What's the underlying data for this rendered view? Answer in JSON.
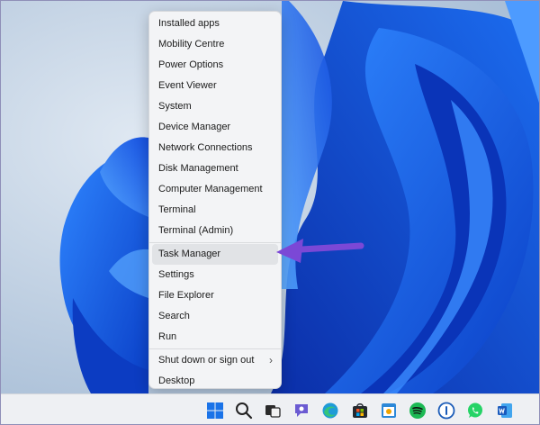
{
  "context_menu": {
    "items": [
      {
        "label": "Installed apps"
      },
      {
        "label": "Mobility Centre"
      },
      {
        "label": "Power Options"
      },
      {
        "label": "Event Viewer"
      },
      {
        "label": "System"
      },
      {
        "label": "Device Manager"
      },
      {
        "label": "Network Connections"
      },
      {
        "label": "Disk Management"
      },
      {
        "label": "Computer Management"
      },
      {
        "label": "Terminal"
      },
      {
        "label": "Terminal (Admin)"
      },
      {
        "label": "Task Manager"
      },
      {
        "label": "Settings"
      },
      {
        "label": "File Explorer"
      },
      {
        "label": "Search"
      },
      {
        "label": "Run"
      },
      {
        "label": "Shut down or sign out"
      },
      {
        "label": "Desktop"
      }
    ],
    "highlighted_item": "Task Manager",
    "submenu_chevron": "›"
  },
  "annotation": {
    "arrow_color": "#7b48d6",
    "points_to": "Task Manager"
  },
  "taskbar": {
    "icons": [
      {
        "name": "start-icon"
      },
      {
        "name": "search-icon"
      },
      {
        "name": "task-view-icon"
      },
      {
        "name": "chat-icon"
      },
      {
        "name": "edge-icon"
      },
      {
        "name": "store-icon"
      },
      {
        "name": "calendar-app-icon"
      },
      {
        "name": "spotify-icon"
      },
      {
        "name": "password-manager-icon"
      },
      {
        "name": "whatsapp-icon"
      },
      {
        "name": "word-icon"
      }
    ]
  },
  "colors": {
    "accent_blue": "#1a5ee6",
    "menu_background": "#f3f4f6",
    "taskbar_background": "#eef0f3"
  }
}
